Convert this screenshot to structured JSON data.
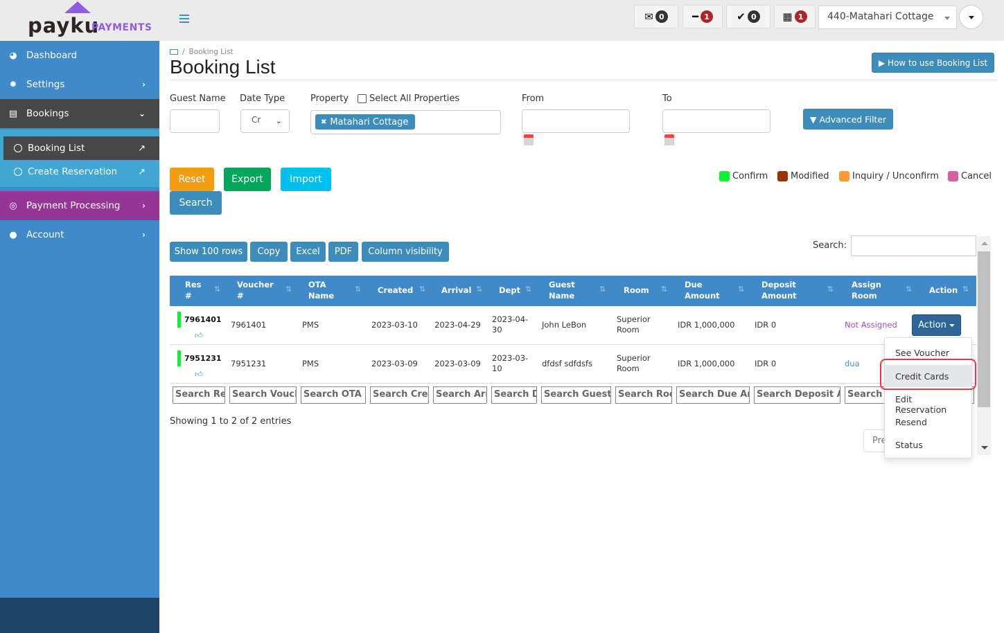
{
  "brand": {
    "name": "payku",
    "suffix": "PAYMENTS"
  },
  "header": {
    "badges": [
      {
        "icon": "envelope-open-icon",
        "glyph": "✉",
        "count": "0",
        "style": "dark"
      },
      {
        "icon": "minus-icon",
        "glyph": "━",
        "count": "1",
        "style": "red"
      },
      {
        "icon": "check-icon",
        "glyph": "✔",
        "count": "0",
        "style": "dark"
      },
      {
        "icon": "calendar-icon",
        "glyph": "▦",
        "count": "1",
        "style": "red"
      }
    ],
    "property_select": "440-Matahari Cottage"
  },
  "sidebar": {
    "items": [
      {
        "label": "Dashboard",
        "icon": "dashboard-icon"
      },
      {
        "label": "Settings",
        "icon": "gear-icon"
      },
      {
        "label": "Bookings",
        "icon": "bookings-icon"
      },
      {
        "label": "Payment Processing",
        "icon": "target-icon"
      },
      {
        "label": "Account",
        "icon": "user-icon"
      }
    ],
    "submenu": [
      {
        "label": "Booking List",
        "active": true
      },
      {
        "label": "Create Reservation",
        "active": false
      }
    ]
  },
  "page": {
    "breadcrumb": "Booking List",
    "title": "Booking List",
    "howto_label": "How to use Booking List"
  },
  "filters": {
    "guest_name_label": "Guest Name",
    "guest_name_value": "",
    "date_type_label": "Date Type",
    "date_type_value": "Cr",
    "property_label": "Property",
    "select_all_label": "Select All Properties",
    "property_tag": "Matahari Cottage",
    "from_label": "From",
    "to_label": "To",
    "advanced_filter_label": "Advanced Filter"
  },
  "actions": {
    "reset": "Reset",
    "export": "Export",
    "import": "Import",
    "search": "Search"
  },
  "legend": [
    {
      "label": "Confirm",
      "color": "#0bf332"
    },
    {
      "label": "Modified",
      "color": "#993300"
    },
    {
      "label": "Inquiry / Unconfirm",
      "color": "#ff9933"
    },
    {
      "label": "Cancel",
      "color": "#d3629f"
    }
  ],
  "table_tools": {
    "buttons": [
      "Show 100 rows",
      "Copy",
      "Excel",
      "PDF",
      "Column visibility"
    ],
    "search_label": "Search:",
    "search_value": ""
  },
  "table": {
    "columns": [
      [
        "Res",
        "#"
      ],
      [
        "Voucher",
        "#"
      ],
      [
        "OTA",
        "Name"
      ],
      [
        "Created"
      ],
      [
        "Arrival"
      ],
      [
        "Dept"
      ],
      [
        "Guest",
        "Name"
      ],
      [
        "Room"
      ],
      [
        "Due",
        "Amount"
      ],
      [
        "Deposit",
        "Amount"
      ],
      [
        "Assign",
        "Room"
      ],
      [
        "Action"
      ]
    ],
    "rows": [
      {
        "res": "7961401",
        "voucher": "7961401",
        "ota": "PMS",
        "created": "2023-03-10",
        "arrival": "2023-04-29",
        "dept": [
          "2023-04-",
          "30"
        ],
        "guest": "John LeBon",
        "room": [
          "Superior",
          "Room"
        ],
        "due": "IDR 1,000,000",
        "deposit": "IDR 0",
        "assign": "Not Assigned",
        "assign_color": "#9b4fd8"
      },
      {
        "res": "7951231",
        "voucher": "7951231",
        "ota": "PMS",
        "created": "2023-03-09",
        "arrival": "2023-03-09",
        "dept": [
          "2023-03-",
          "10"
        ],
        "guest": "dfdsf sdfdsfs",
        "room": [
          "Superior",
          "Room"
        ],
        "due": "IDR 1,000,000",
        "deposit": "IDR 0",
        "assign": "dua",
        "assign_color": "#3c8dc8"
      }
    ],
    "action_label": "Action",
    "column_search": [
      "Search  Re",
      "Search Vouch",
      "Search OTA N",
      "Search Crea",
      "Search Arr",
      "Search D",
      "Search Guest N",
      "Search Roo",
      "Search Due Am",
      "Search Deposit Ai",
      "Search A"
    ],
    "info": "Showing 1 to 2 of 2 entries",
    "prev_label": "Pre"
  },
  "action_menu": {
    "items": [
      "See Voucher",
      "Credit Cards",
      "Edit Reservation",
      "Resend",
      "Status"
    ],
    "highlighted": "Credit Cards"
  }
}
